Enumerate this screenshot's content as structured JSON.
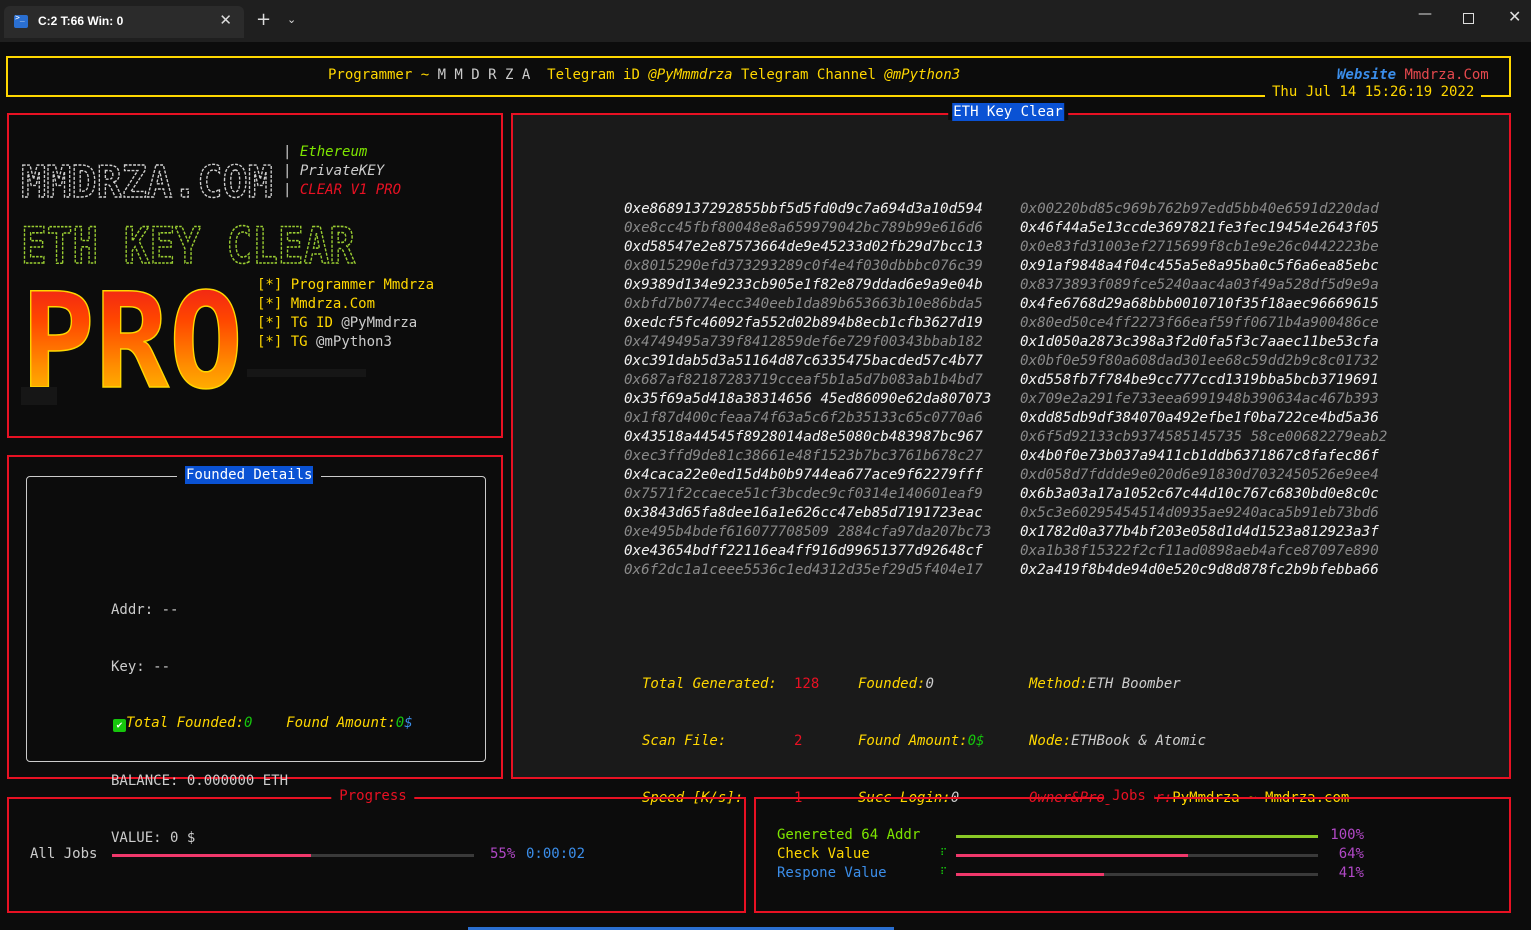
{
  "window": {
    "tab_title": "C:2 T:66 Win: 0",
    "tab_close": "✕",
    "new_tab": "+",
    "dropdown": "⌄",
    "minimize": "—",
    "close": "✕",
    "accent_color": "#2a6fd1"
  },
  "header": {
    "programmer_label": "Programmer ~ ",
    "programmer_name": "M M D R Z A ",
    "telegram_id_label": " Telegram iD ",
    "telegram_id": "@PyMmmdrza",
    "telegram_channel_label": " Telegram Channel ",
    "telegram_channel": "@mPython3",
    "website_label": "Website",
    "website_url": "Mmdrza.Com",
    "datetime": "Thu Jul 14 15:26:19 2022",
    "border_color": "#ffd700"
  },
  "banner": {
    "logo_text": "MMDRZA.COM",
    "title_art": "ETH KEY CLEAR",
    "pro_art": "PRO",
    "info": [
      "Ethereum",
      "PrivateKEY",
      "CLEAR V1 PRO"
    ],
    "separator": "|",
    "bullets": [
      {
        "tag": "[*]",
        "label": "Programmer",
        "value": "Mmdrza"
      },
      {
        "tag": "[*]",
        "label": "Mmdrza.Com",
        "value": ""
      },
      {
        "tag": "[*]",
        "label": "TG ID",
        "value": "@PyMmdrza"
      },
      {
        "tag": "[*]",
        "label": "TG",
        "value": "@mPython3"
      }
    ]
  },
  "founded": {
    "title": "Founded Details",
    "addr_label": "Addr:",
    "addr_value": "--",
    "key_label": "Key:",
    "key_value": "--",
    "balance_label": "BALANCE:",
    "balance_value": "0.000000 ETH",
    "value_label": "VALUE:",
    "value_value": "0 $",
    "total_label": "Total Founded:",
    "total_value": "0",
    "amount_label": "Found Amount:",
    "amount_value": "0",
    "amount_unit": "$"
  },
  "eth_panel": {
    "title": "ETH Key Clear",
    "rows": [
      {
        "left": "0xe8689137292855bbf5d5fd0d9c7a694d3a10d594",
        "right": "0x00220bd85c969b762b97edd5bb40e6591d220dad",
        "bright": "left"
      },
      {
        "left": "0xe8cc45fbf80048e8a659979042bc789b99e616d6",
        "right": "0x46f44a5e13ccde3697821fe3fec19454e2643f05",
        "bright": "right"
      },
      {
        "left": "0xd58547e2e87573664de9e45233d02fb29d7bcc13",
        "right": "0x0e83fd31003ef2715699f8cb1e9e26c0442223be",
        "bright": "left"
      },
      {
        "left": "0x8015290efd373293289c0f4e4f030dbbbc076c39",
        "right": "0x91af9848a4f04c455a5e8a95ba0c5f6a6ea85ebc",
        "bright": "right"
      },
      {
        "left": "0x9389d134e9233cb905e1f82e879ddad6e9a9e04b",
        "right": "0x8373893f089fce5240aac4a03f49a528df5d9e9a",
        "bright": "left"
      },
      {
        "left": "0xbfd7b0774ecc340eeb1da89b653663b10e86bda5",
        "right": "0x4fe6768d29a68bbb0010710f35f18aec96669615",
        "bright": "right"
      },
      {
        "left": "0xedcf5fc46092fa552d02b894b8ecb1cfb3627d19",
        "right": "0x80ed50ce4ff2273f66eaf59ff0671b4a900486ce",
        "bright": "left"
      },
      {
        "left": "0x4749495a739f8412859def6e729f00343bbab182",
        "right": "0x1d050a2873c398a3f2d0fa5f3c7aaec11be53cfa",
        "bright": "right"
      },
      {
        "left": "0xc391dab5d3a51164d87c6335475bacded57c4b77",
        "right": "0x0bf0e59f80a608dad301ee68c59dd2b9c8c01732",
        "bright": "left"
      },
      {
        "left": "0x687af82187283719cceaf5b1a5d7b083ab1b4bd7",
        "right": "0xd558fb7f784be9cc777ccd1319bba5bcb3719691",
        "bright": "right"
      },
      {
        "left": "0x35f69a5d418a38314656 45ed86090e62da807073",
        "right": "0x709e2a291fe733eea6991948b390634ac467b393",
        "bright": "left"
      },
      {
        "left": "0x1f87d400cfeaa74f63a5c6f2b35133c65c0770a6",
        "right": "0xdd85db9df384070a492efbe1f0ba722ce4bd5a36",
        "bright": "right"
      },
      {
        "left": "0x43518a44545f8928014ad8e5080cb483987bc967",
        "right": "0x6f5d92133cb9374585145735 58ce00682279eab2",
        "bright": "left"
      },
      {
        "left": "0xec3ffd9de81c38661e48f1523b7bc3761b678c27",
        "right": "0x4b0f0e73b037a9411cb1ddb6371867c8fafec86f",
        "bright": "right"
      },
      {
        "left": "0x4caca22e0ed15d4b0b9744ea677ace9f62279fff",
        "right": "0xd058d7fddde9e020d6e91830d7032450526e9ee4",
        "bright": "left"
      },
      {
        "left": "0x7571f2ccaece51cf3bcdec9cf0314e140601eaf9",
        "right": "0x6b3a03a17a1052c67c44d10c767c6830bd0e8c0c",
        "bright": "right"
      },
      {
        "left": "0x3843d65fa8dee16a1e626cc47eb85d7191723eac",
        "right": "0x5c3e60295454514d0935ae9240aca5b91eb73bd6",
        "bright": "left"
      },
      {
        "left": "0xe495b4bdef616077708509 2884cfa97da207bc73",
        "right": "0x1782d0a377b4bf203e058d1d4d1523a812923a3f",
        "bright": "right"
      },
      {
        "left": "0xe43654bdff22116ea4ff916d99651377d92648cf",
        "right": "0xa1b38f15322f2cf11ad0898aeb4afce87097e890",
        "bright": "left"
      },
      {
        "left": "0x6f2dc1a1ceee5536c1ed4312d35ef29d5f404e17",
        "right": "0x2a419f8b4de94d0e520c9d8d878fc2b9bfebba66",
        "bright": "right"
      }
    ],
    "stats": {
      "total_generated_label": "Total Generated:",
      "total_generated": "128",
      "scan_file_label": "Scan File:",
      "scan_file": "2",
      "speed_label": "Speed [K/s]:",
      "speed": "1",
      "founded_label": "Founded:",
      "founded": "0",
      "found_amount_label": "Found Amount:",
      "found_amount": "0",
      "found_amount_unit": "$",
      "succ_login_label": "Succ Login:",
      "succ_login": "0",
      "method_label": "Method:",
      "method": "ETH Boomber",
      "node_label": "Node:",
      "node": "ETHBook & Atomic",
      "owner_label": "Owner&Programmer:",
      "owner": "PyMmdrza ~ Mmdrza.com"
    }
  },
  "progress": {
    "title": "Progress",
    "label": "All Jobs",
    "percent_text": "55%",
    "fraction": 0.55,
    "elapsed": "0:00:02",
    "bar_color": "#f0386b"
  },
  "jobs": {
    "title": "Jobs",
    "items": [
      {
        "name": "Genereted 64 Addr",
        "percent_text": "100%",
        "fraction": 1.0,
        "color": "#7ee600",
        "bar_color": "#8ac926",
        "spinner": ""
      },
      {
        "name": "Check Value",
        "percent_text": "64%",
        "fraction": 0.64,
        "color": "#ffd700",
        "bar_color": "#f0386b",
        "spinner": "⠏"
      },
      {
        "name": "Respone Value",
        "percent_text": "41%",
        "fraction": 0.41,
        "color": "#3b8eea",
        "bar_color": "#f0386b",
        "spinner": "⠏"
      }
    ]
  }
}
